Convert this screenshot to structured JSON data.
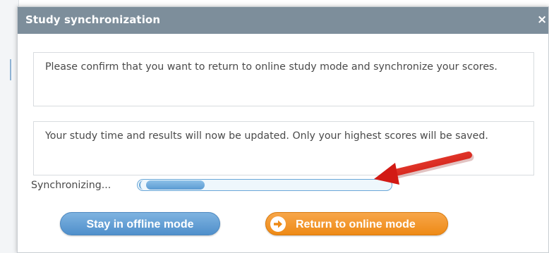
{
  "dialog": {
    "title": "Study synchronization",
    "close_label": "×"
  },
  "messages": {
    "confirm": "Please confirm that you want to return to online study mode and synchronize your scores.",
    "info": "Your study time and results will now be updated. Only your highest scores will be saved."
  },
  "sync": {
    "label": "Synchronizing...",
    "progress_fraction": 0.24
  },
  "buttons": {
    "offline_label": "Stay in offline mode",
    "online_label": "Return to online mode"
  },
  "colors": {
    "titlebar": "#7d8e9b",
    "offline_button": "#5b9bd2",
    "online_button": "#ee8a16",
    "annotation_arrow": "#e0201a"
  },
  "icons": {
    "close": "close-icon",
    "online_button_icon": "arrow-right-circle-icon",
    "annotation": "red-arrow-icon"
  }
}
